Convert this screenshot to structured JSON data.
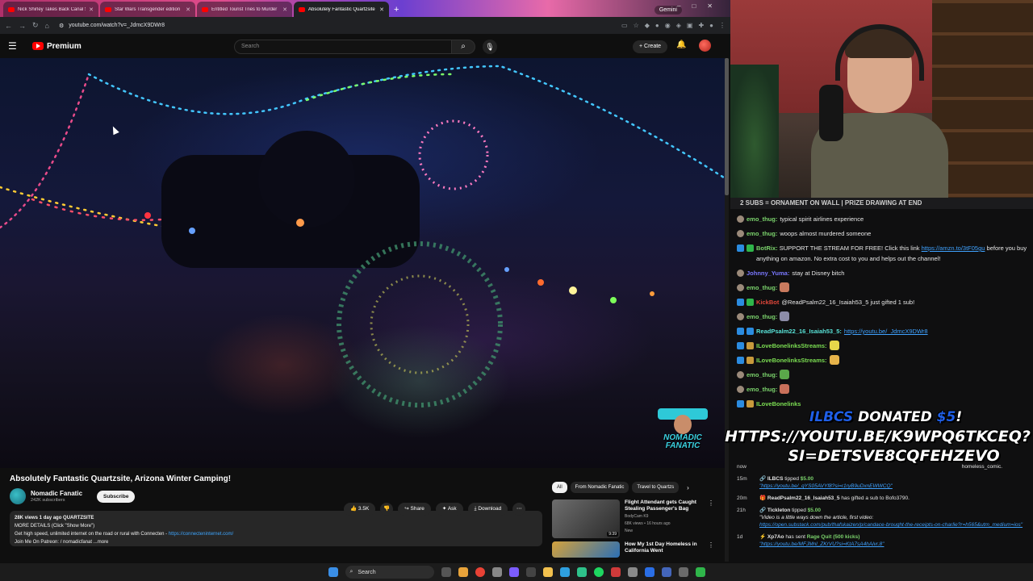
{
  "browser": {
    "tabs": [
      {
        "title": "Nick Shirley Takes Back Canal S",
        "active": false
      },
      {
        "title": "Star Wars Transgender edition",
        "active": false
      },
      {
        "title": "Entitled Tourist Tries to Murder",
        "active": false
      },
      {
        "title": "Absolutely Fantastic Quartzsite",
        "active": true
      }
    ],
    "gemini_label": "Gemini",
    "url": "youtube.com/watch?v=_JdmcX9DWr8"
  },
  "youtube": {
    "brand": "Premium",
    "search_placeholder": "Search",
    "create_label": "Create",
    "video_title": "Absolutely Fantastic Quartzsite, Arizona Winter Camping!",
    "channel_name": "Nomadic Fanatic",
    "subscribers": "242K subscribers",
    "subscribe_label": "Subscribe",
    "likes": "3.5K",
    "share_label": "Share",
    "ask_label": "Ask",
    "download_label": "Download",
    "watermark": "NOMADIC FANATIC",
    "description": {
      "stats": "28K views  1 day ago  QUARTZSITE",
      "line1": "MORE DETAILS (Click \"Show More\")",
      "line2": "Get high speed, unlimited internet on the road or rural with Connecten - ",
      "line2_link": "https://connecteninternet.com/",
      "line3": "Join Me On Patreon: ",
      "line3_rest": " / nomadicfanat  ...more"
    },
    "chips": [
      "All",
      "From Nomadic Fanatic",
      "Travel to Quartzs"
    ],
    "related": [
      {
        "title": "Flight Attendant gets Caught Stealing Passenger's Bag",
        "channel": "BodyCam K9",
        "views": "68K views • 16 hours ago",
        "badge": "New",
        "duration": "9:39"
      },
      {
        "title": "How My 1st Day Homeless in California Went",
        "channel": "",
        "views": "",
        "badge": "",
        "duration": ""
      }
    ]
  },
  "chat": {
    "banner": "2 SUBS = ORNAMENT ON WALL | PRIZE DRAWING AT END",
    "messages": [
      {
        "user": "emo_thug:",
        "text": "typical spirit airlines experience",
        "color": "green",
        "icon": "gray"
      },
      {
        "user": "emo_thug:",
        "text": "woops almost murdered someone",
        "color": "green",
        "icon": "gray"
      },
      {
        "user": "BotRix:",
        "text": "SUPPORT THE STREAM FOR FREE! Click this link ",
        "link": "https://amzn.to/3tF05gu",
        "text2": " before you buy anything on amazon. No extra cost to you and helps out the channel!",
        "color": "green",
        "icon": "blue"
      },
      {
        "user": "Johnny_Yuma:",
        "text": "stay at Disney bitch",
        "color": "purple",
        "icon": "gray"
      },
      {
        "user": "emo_thug:",
        "text": "",
        "color": "green",
        "icon": "gray",
        "emote": true
      },
      {
        "user": "KickBot",
        "text": "@ReadPsalm22_16_Isaiah53_5 just gifted 1 sub!",
        "color": "red",
        "icon": "blue"
      },
      {
        "user": "emo_thug:",
        "text": "",
        "color": "green",
        "icon": "gray",
        "emote": true
      },
      {
        "user": "ReadPsalm22_16_Isaiah53_5:",
        "text": "",
        "link": "https://youtu.be/_JdmcX9DWr8",
        "color": "teal",
        "icon": "blue"
      },
      {
        "user": "ILoveBonelinksStreams:",
        "text": "",
        "color": "lime",
        "icon": "blue",
        "emote": true
      },
      {
        "user": "ILoveBonelinksStreams:",
        "text": "",
        "color": "lime",
        "icon": "blue",
        "emote": true
      },
      {
        "user": "emo_thug:",
        "text": "",
        "color": "green",
        "icon": "gray",
        "emote": true
      },
      {
        "user": "emo_thug:",
        "text": "",
        "color": "green",
        "icon": "gray",
        "emote": true
      },
      {
        "user": "ILoveBonelinks",
        "text": "",
        "color": "lime",
        "icon": "blue"
      }
    ],
    "donation_overlay": {
      "name": "ILBCS",
      "line1_mid": "DONATED",
      "amount": "$5",
      "line1_end": "!",
      "line2": "HTTPS://YOUTU.BE/K9WPQ6TKCEQ?",
      "line3": "SI=DETSVE8CQFEHZEVO"
    },
    "events": [
      {
        "time": "now",
        "text": "",
        "extra": "homeless_comic."
      },
      {
        "time": "15m",
        "user": "ILBCS",
        "action": "tipped",
        "amount": "$5.00",
        "link": "\"https://youtu.be/_qYS05AVYf8?si=r1ryB9uDxnEWWCQ\""
      },
      {
        "time": "20m",
        "user": "ReadPsalm22_16_Isaiah53_5",
        "action": "has gifted a sub to Bofo3790.",
        "amount": ""
      },
      {
        "time": "21h",
        "user": "Tickleton",
        "action": "tipped",
        "amount": "$5.00",
        "note": "\"Video is a little ways down the article, first video:",
        "link": "https://open.substack.com/pub/thafskaizen/p/candace-brought-the-receipts-on-charlie?r=h565&utm_medium=ios\""
      },
      {
        "time": "1d",
        "user": "Xp7Ao",
        "action": "has sent",
        "amount": "Rage Quit (500 kicks)",
        "link": "\"https://youtu.be/MFJMnl_ZKrVU?si=KtA7sA4hAlvr.8\""
      }
    ]
  },
  "taskbar": {
    "search_label": "Search"
  },
  "colors": {
    "yt_red": "#ff0000",
    "link_blue": "#3ea6ff",
    "chat_green": "#7bd36c",
    "chat_purple": "#7a78ff"
  }
}
